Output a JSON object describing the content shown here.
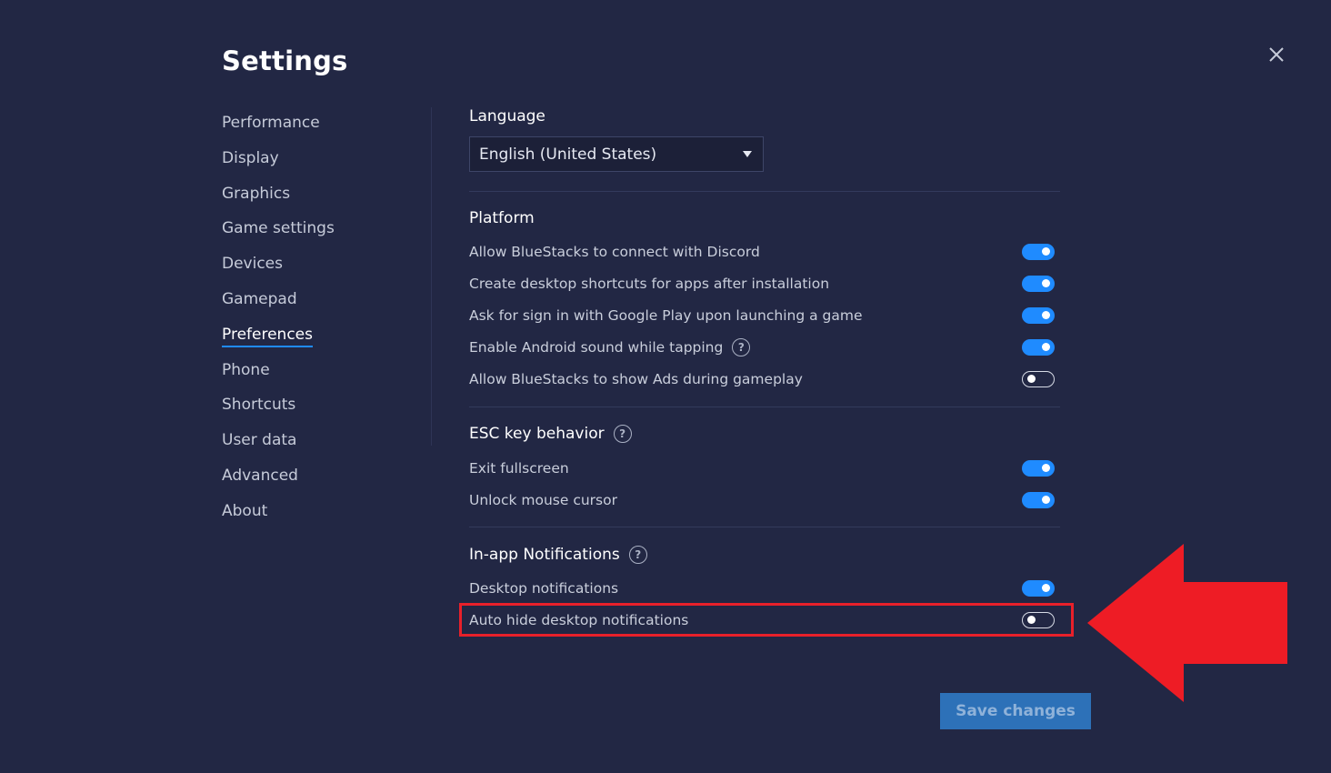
{
  "header": {
    "title": "Settings",
    "close_icon": "close-icon"
  },
  "sidebar": {
    "items": [
      {
        "label": "Performance",
        "active": false
      },
      {
        "label": "Display",
        "active": false
      },
      {
        "label": "Graphics",
        "active": false
      },
      {
        "label": "Game settings",
        "active": false
      },
      {
        "label": "Devices",
        "active": false
      },
      {
        "label": "Gamepad",
        "active": false
      },
      {
        "label": "Preferences",
        "active": true
      },
      {
        "label": "Phone",
        "active": false
      },
      {
        "label": "Shortcuts",
        "active": false
      },
      {
        "label": "User data",
        "active": false
      },
      {
        "label": "Advanced",
        "active": false
      },
      {
        "label": "About",
        "active": false
      }
    ]
  },
  "language": {
    "title": "Language",
    "selected": "English (United States)"
  },
  "platform": {
    "title": "Platform",
    "items": [
      {
        "label": "Allow BlueStacks to connect with Discord",
        "on": true
      },
      {
        "label": "Create desktop shortcuts for apps after installation",
        "on": true
      },
      {
        "label": "Ask for sign in with Google Play upon launching a game",
        "on": true
      },
      {
        "label": "Enable Android sound while tapping",
        "on": true,
        "help": true
      },
      {
        "label": "Allow BlueStacks to show Ads during gameplay",
        "on": false
      }
    ]
  },
  "esc": {
    "title": "ESC key behavior",
    "help": true,
    "items": [
      {
        "label": "Exit fullscreen",
        "on": true
      },
      {
        "label": "Unlock mouse cursor",
        "on": true
      }
    ]
  },
  "notifications": {
    "title": "In-app Notifications",
    "help": true,
    "items": [
      {
        "label": "Desktop notifications",
        "on": true
      },
      {
        "label": "Auto hide desktop notifications",
        "on": false
      }
    ]
  },
  "help_glyph": "?",
  "footer": {
    "save_label": "Save changes"
  },
  "colors": {
    "background": "#222744",
    "accent": "#1f8bff",
    "highlight": "#e8202a",
    "save_button": "#2d71b8"
  }
}
